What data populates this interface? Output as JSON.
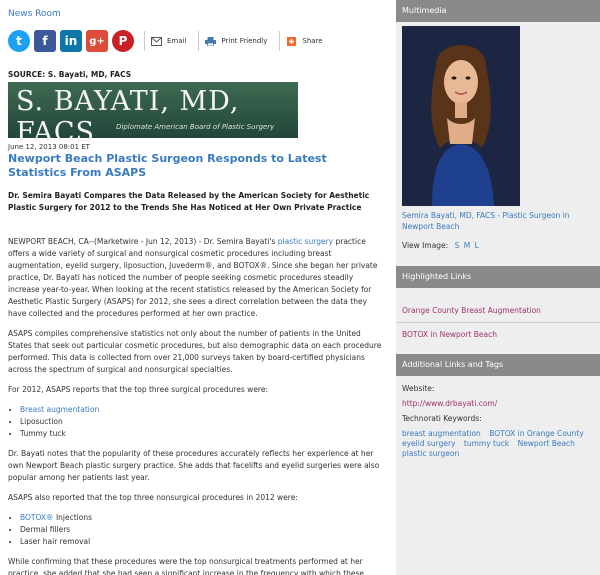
{
  "newsroom": {
    "label": "News Room"
  },
  "share": {
    "twitter": "t",
    "facebook": "f",
    "linkedin": "in",
    "googleplus": "g+",
    "pinterest": "P",
    "email": "Email",
    "print": "Print Friendly",
    "share": "Share"
  },
  "article": {
    "source": "SOURCE: S. Bayati, MD, FACS",
    "logo_title": "S. BAYATI, MD, FACS",
    "logo_subtitle": "Diplomate American Board of Plastic Surgery",
    "date": "June 12, 2013 08:01 ET",
    "headline": "Newport Beach Plastic Surgeon Responds to Latest Statistics From ASAPS",
    "subhead": "Dr. Semira Bayati Compares the Data Released by the American Society for Aesthetic Plastic Surgery for 2012 to the Trends She Has Noticed at Her Own Private Practice",
    "p1_a": "NEWPORT BEACH, CA--(Marketwire - Jun 12, 2013) - Dr. Semira Bayati's ",
    "p1_link": "plastic surgery",
    "p1_b": " practice offers a wide variety of surgical and nonsurgical cosmetic procedures including breast augmentation, eyelid surgery, liposuction, Juvederm®, and BOTOX®. Since she began her private practice, Dr. Bayati has noticed the number of people seeking cosmetic procedures steadily increase year-to-year. When looking at the recent statistics released by the American Society for Aesthetic Plastic Surgery (ASAPS) for 2012, she sees a direct correlation between the data they have collected and the procedures performed at her own practice.",
    "p2": "ASAPS compiles comprehensive statistics not only about the number of patients in the United States that seek out particular cosmetic procedures, but also demographic data on each procedure performed. This data is collected from over 21,000 surveys taken by board-certified physicians across the spectrum of surgical and nonsurgical specialties.",
    "p3": "For 2012, ASAPS reports that the top three surgical procedures were:",
    "surgical": [
      "Breast augmentation",
      "Liposuction",
      "Tummy tuck"
    ],
    "p4": "Dr. Bayati notes that the popularity of these procedures accurately reflects her experience at her own Newport Beach plastic surgery practice. She adds that facelifts and eyelid surgeries were also popular among her patients last year.",
    "p5": "ASAPS also reported that the top three nonsurgical procedures in 2012 were:",
    "nonsurgical_link": "BOTOX®",
    "nonsurgical_1_rest": " Injections",
    "nonsurgical": [
      "Dermal fillers",
      "Laser hair removal"
    ],
    "p6": "While confirming that these procedures were the top nonsurgical treatments performed at her practice, she added that she had seen a significant increase in the frequency with which these"
  },
  "sidebar": {
    "multimedia": "Multimedia",
    "caption": "Semira Bayati, MD, FACS - Plastic Surgeon in Newport Beach",
    "view_image": "View Image:",
    "sizes": [
      "S",
      "M",
      "L"
    ],
    "highlighted": "Highlighted Links",
    "links": [
      "Orange County Breast Augmentation",
      "BOTOX in Newport Beach"
    ],
    "additional": "Additional Links and Tags",
    "website_label": "Website:",
    "website": "http://www.drbayati.com/",
    "technorati_label": "Technorati Keywords:",
    "tags": [
      "breast augmentation",
      "BOTOX in Orange County",
      "eyelid surgery",
      "tummy tuck",
      "Newport Beach",
      "plastic surgeon"
    ]
  }
}
